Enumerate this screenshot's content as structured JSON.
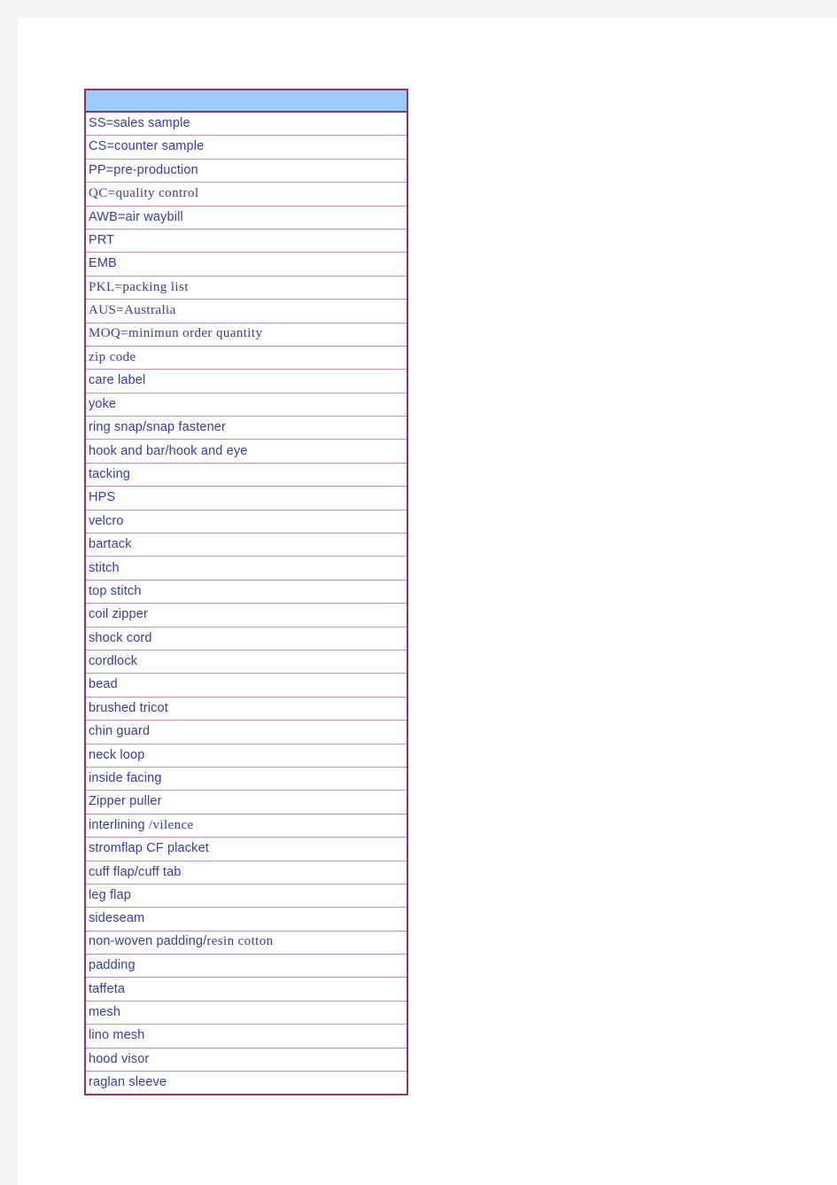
{
  "document": {
    "background_color": "#ffffff",
    "canvas_color": "#f4f4f4"
  },
  "table": {
    "name": "apparel-terminology-glossary",
    "border_color": "#993366",
    "inner_border_color": "#c98fad",
    "text_color": "#3a3aae",
    "header_fill": "#9bcbfa",
    "column_count": 1,
    "header": {
      "label": ""
    },
    "rows": [
      {
        "text": "SS=sales  sample",
        "font": "sans"
      },
      {
        "text": "CS=counter  sample",
        "font": "sans"
      },
      {
        "text": "PP=pre-production",
        "font": "sans"
      },
      {
        "text": "QC=quality control",
        "font": "serif"
      },
      {
        "text": "AWB=air  waybill",
        "font": "sans"
      },
      {
        "text": "PRT",
        "font": "sans"
      },
      {
        "text": "EMB",
        "font": "sans"
      },
      {
        "text": "PKL=packing list",
        "font": "serif"
      },
      {
        "text": "AUS=Australia",
        "font": "serif"
      },
      {
        "text": "MOQ=minimun order quantity",
        "font": "serif"
      },
      {
        "text": "zip code",
        "font": "serif"
      },
      {
        "text": "care label",
        "font": "sans"
      },
      {
        "text": "yoke",
        "font": "sans"
      },
      {
        "text": "ring  snap/snap  fastener",
        "font": "sans"
      },
      {
        "text": "hook  and  bar/hook  and  eye",
        "font": "sans"
      },
      {
        "text": "tacking",
        "font": "sans"
      },
      {
        "text": "HPS",
        "font": "sans"
      },
      {
        "text": "velcro",
        "font": "sans"
      },
      {
        "text": "bartack",
        "font": "sans"
      },
      {
        "text": "stitch",
        "font": "sans"
      },
      {
        "text": "top  stitch",
        "font": "sans"
      },
      {
        "text": "coil  zipper",
        "font": "sans"
      },
      {
        "text": "shock  cord",
        "font": "sans"
      },
      {
        "text": "cordlock",
        "font": "sans"
      },
      {
        "text": "bead",
        "font": "sans"
      },
      {
        "text": "brushed  tricot",
        "font": "sans"
      },
      {
        "text": "chin  guard",
        "font": "sans"
      },
      {
        "text": "neck  loop",
        "font": "sans"
      },
      {
        "text": "inside  facing",
        "font": "sans"
      },
      {
        "text": "Zipper  puller",
        "font": "sans"
      },
      {
        "text": "interlining ",
        "font": "sans",
        "suffix_text": "/vilence",
        "suffix_font": "serif"
      },
      {
        "text": "stromflap   CF  placket",
        "font": "sans"
      },
      {
        "text": "cuff  flap/cuff  tab",
        "font": "sans"
      },
      {
        "text": "leg flap",
        "font": "sans"
      },
      {
        "text": "sideseam",
        "font": "sans"
      },
      {
        "text": "non-woven  padding/",
        "font": "sans",
        "suffix_text": "resin cotton",
        "suffix_font": "serif"
      },
      {
        "text": "padding",
        "font": "sans"
      },
      {
        "text": "taffeta",
        "font": "sans"
      },
      {
        "text": "mesh",
        "font": "sans"
      },
      {
        "text": "lino  mesh",
        "font": "sans"
      },
      {
        "text": "hood  visor",
        "font": "sans"
      },
      {
        "text": "raglan  sleeve",
        "font": "sans"
      }
    ]
  }
}
